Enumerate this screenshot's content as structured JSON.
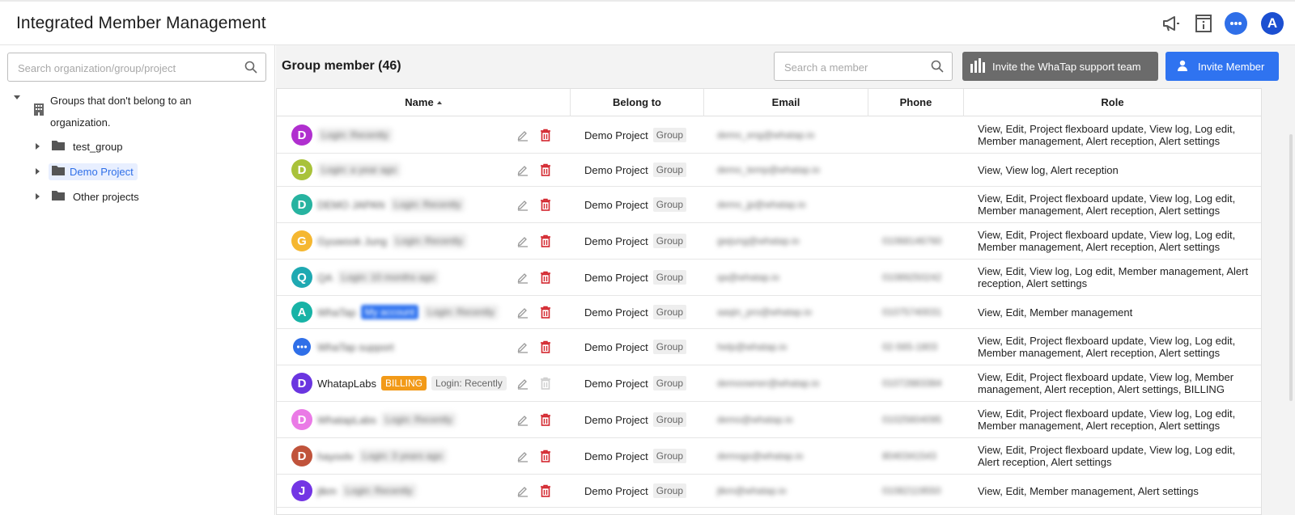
{
  "header": {
    "title": "Integrated Member Management",
    "avatar_letter": "A"
  },
  "sidebar": {
    "search_placeholder": "Search organization/group/project",
    "root_label": "Groups that don't belong to an organization.",
    "items": [
      {
        "label": "test_group"
      },
      {
        "label": "Demo Project"
      },
      {
        "label": "Other projects"
      }
    ]
  },
  "main": {
    "title": "Group member (46)",
    "search_placeholder": "Search a member",
    "support_button": "Invite the WhaTap support team",
    "invite_button": "Invite Member",
    "columns": {
      "name": "Name",
      "belong": "Belong to",
      "email": "Email",
      "phone": "Phone",
      "role": "Role"
    },
    "rows": [
      {
        "letter": "D",
        "color": "#b02fcf",
        "name": "",
        "login": "Login: Recently",
        "belong": "Demo Project",
        "group": "Group",
        "email": "demo_eng@whatap.io",
        "phone": "",
        "role": "View, Edit, Project flexboard update, View log, Log edit, Member management, Alert reception, Alert settings"
      },
      {
        "letter": "D",
        "color": "#a9c23a",
        "name": "",
        "login": "Login: a year ago",
        "belong": "Demo Project",
        "group": "Group",
        "email": "demo_temp@whatap.io",
        "phone": "",
        "role": "View, View log, Alert reception"
      },
      {
        "letter": "D",
        "color": "#27b3a0",
        "name": "DEMO JAPAN",
        "login": "Login: Recently",
        "belong": "Demo Project",
        "group": "Group",
        "email": "demo_jp@whatap.io",
        "phone": "",
        "role": "View, Edit, Project flexboard update, View log, Log edit, Member management, Alert reception, Alert settings"
      },
      {
        "letter": "G",
        "color": "#f5b731",
        "name": "Gyuwook Jung",
        "login": "Login: Recently",
        "belong": "Demo Project",
        "group": "Group",
        "email": "gwjung@whatap.io",
        "phone": "01068146760",
        "role": "View, Edit, Project flexboard update, View log, Log edit, Member management, Alert reception, Alert settings"
      },
      {
        "letter": "Q",
        "color": "#1fa9b2",
        "name": "QA",
        "login": "Login: 10 months ago",
        "belong": "Demo Project",
        "group": "Group",
        "email": "qa@whatap.io",
        "phone": "01089250242",
        "role": "View, Edit, View log, Log edit, Member management, Alert reception, Alert settings"
      },
      {
        "letter": "A",
        "color": "#18b3a6",
        "name": "WhaTap",
        "mytag": "My account",
        "login": "Login: Recently",
        "belong": "Demo Project",
        "group": "Group",
        "email": "aaqin_pro@whatap.io",
        "phone": "01075740031",
        "role": "View, Edit, Member management"
      },
      {
        "letter": "",
        "color": "#2f6fe8",
        "icon": "chat",
        "name": "WhaTap support",
        "login": "",
        "belong": "Demo Project",
        "group": "Group",
        "email": "help@whatap.io",
        "phone": "02-565-1803",
        "role": "View, Edit, Project flexboard update, View log, Log edit, Member management, Alert reception, Alert settings"
      },
      {
        "letter": "D",
        "color": "#6a35e0",
        "name": "WhatapLabs",
        "billing": "BILLING",
        "login": "Login: Recently",
        "belong": "Demo Project",
        "group": "Group",
        "email": "demoowner@whatap.io",
        "phone": "01072883384",
        "role": "View, Edit, Project flexboard update, View log, Member management, Alert reception, Alert settings, BILLING",
        "clear": true
      },
      {
        "letter": "D",
        "color": "#ea7ae6",
        "name": "WhatapLabs",
        "login": "Login: Recently",
        "belong": "Demo Project",
        "group": "Group",
        "email": "demo@whatap.io",
        "phone": "01025604095",
        "role": "View, Edit, Project flexboard update, View log, Log edit, Member management, Alert reception, Alert settings"
      },
      {
        "letter": "D",
        "color": "#c0533b",
        "name": "hayoolv",
        "login": "Login: 3 years ago",
        "belong": "Demo Project",
        "group": "Group",
        "email": "demogs@whatap.io",
        "phone": "8040341543",
        "role": "View, Edit, Project flexboard update, View log, Log edit, Alert reception, Alert settings"
      },
      {
        "letter": "J",
        "color": "#7335e4",
        "name": "jtkm",
        "login": "Login: Recently",
        "belong": "Demo Project",
        "group": "Group",
        "email": "jtkm@whatap.io",
        "phone": "01082119550",
        "role": "View, Edit, Member management, Alert settings"
      }
    ]
  }
}
